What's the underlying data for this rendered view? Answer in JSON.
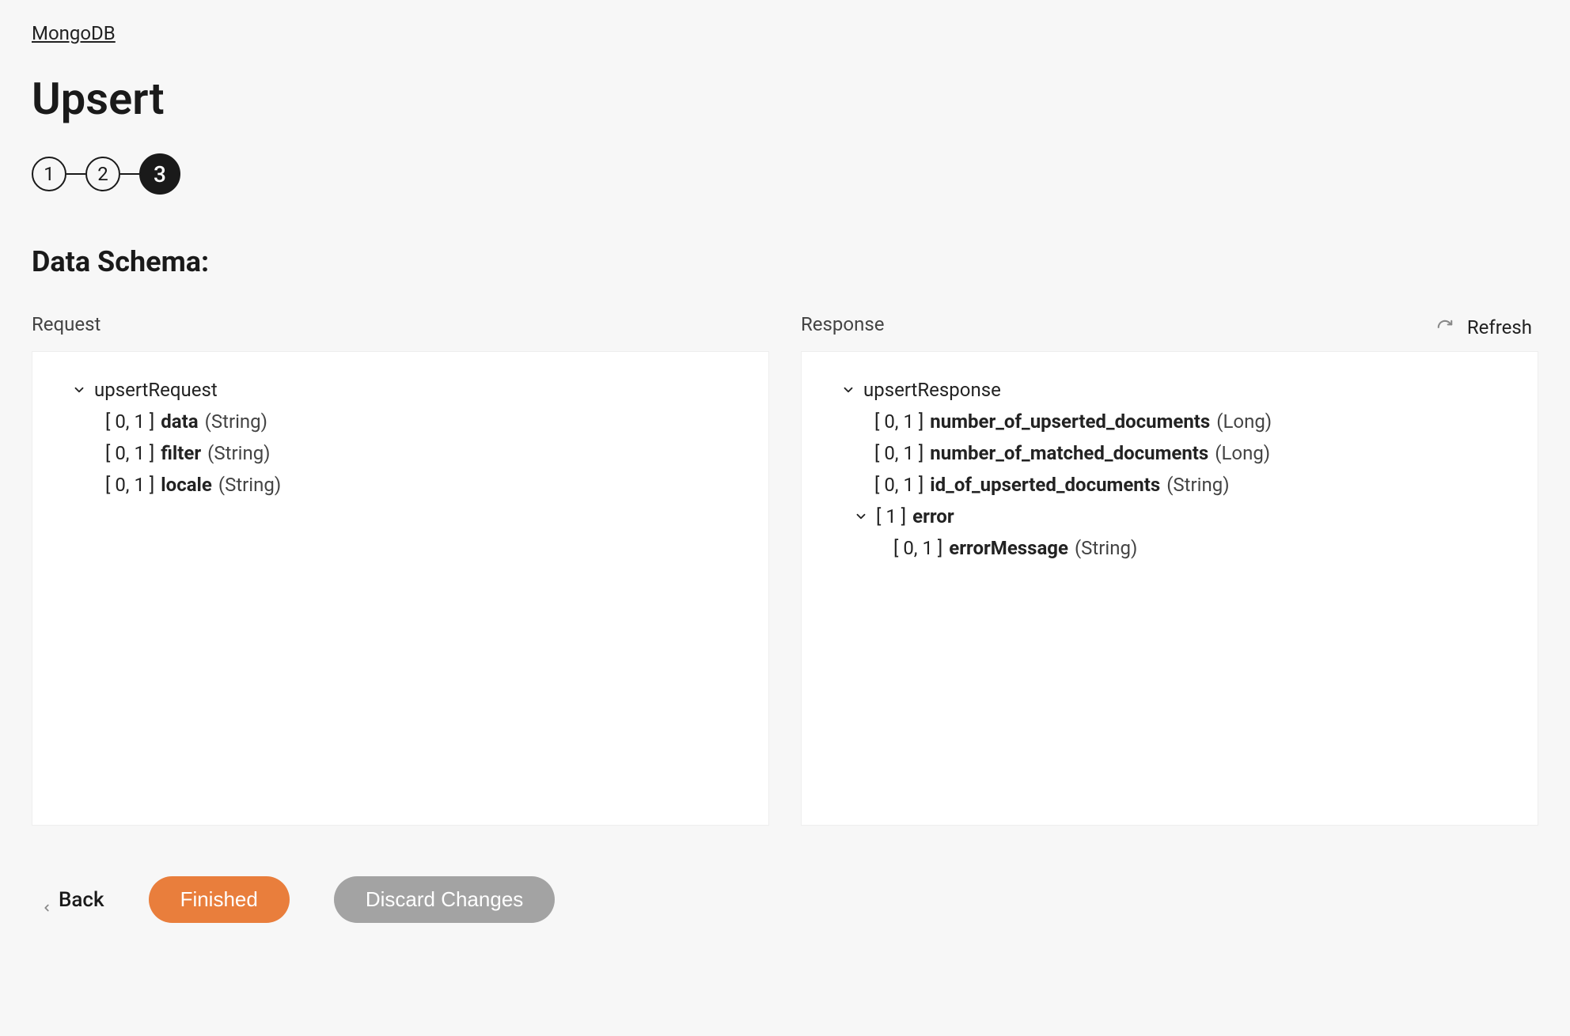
{
  "breadcrumb": "MongoDB",
  "page_title": "Upsert",
  "stepper": {
    "steps": [
      "1",
      "2",
      "3"
    ],
    "active_index": 2
  },
  "section_title": "Data Schema:",
  "refresh_label": "Refresh",
  "panels": {
    "request": {
      "label": "Request",
      "root": "upsertRequest",
      "fields": [
        {
          "card": "[ 0, 1 ]",
          "name": "data",
          "type": "(String)"
        },
        {
          "card": "[ 0, 1 ]",
          "name": "filter",
          "type": "(String)"
        },
        {
          "card": "[ 0, 1 ]",
          "name": "locale",
          "type": "(String)"
        }
      ]
    },
    "response": {
      "label": "Response",
      "root": "upsertResponse",
      "fields": [
        {
          "card": "[ 0, 1 ]",
          "name": "number_of_upserted_documents",
          "type": "(Long)"
        },
        {
          "card": "[ 0, 1 ]",
          "name": "number_of_matched_documents",
          "type": "(Long)"
        },
        {
          "card": "[ 0, 1 ]",
          "name": "id_of_upserted_documents",
          "type": "(String)"
        }
      ],
      "error": {
        "card": "[ 1 ]",
        "name": "error",
        "children": [
          {
            "card": "[ 0, 1 ]",
            "name": "errorMessage",
            "type": "(String)"
          }
        ]
      }
    }
  },
  "footer": {
    "back": "Back",
    "finished": "Finished",
    "discard": "Discard Changes"
  }
}
